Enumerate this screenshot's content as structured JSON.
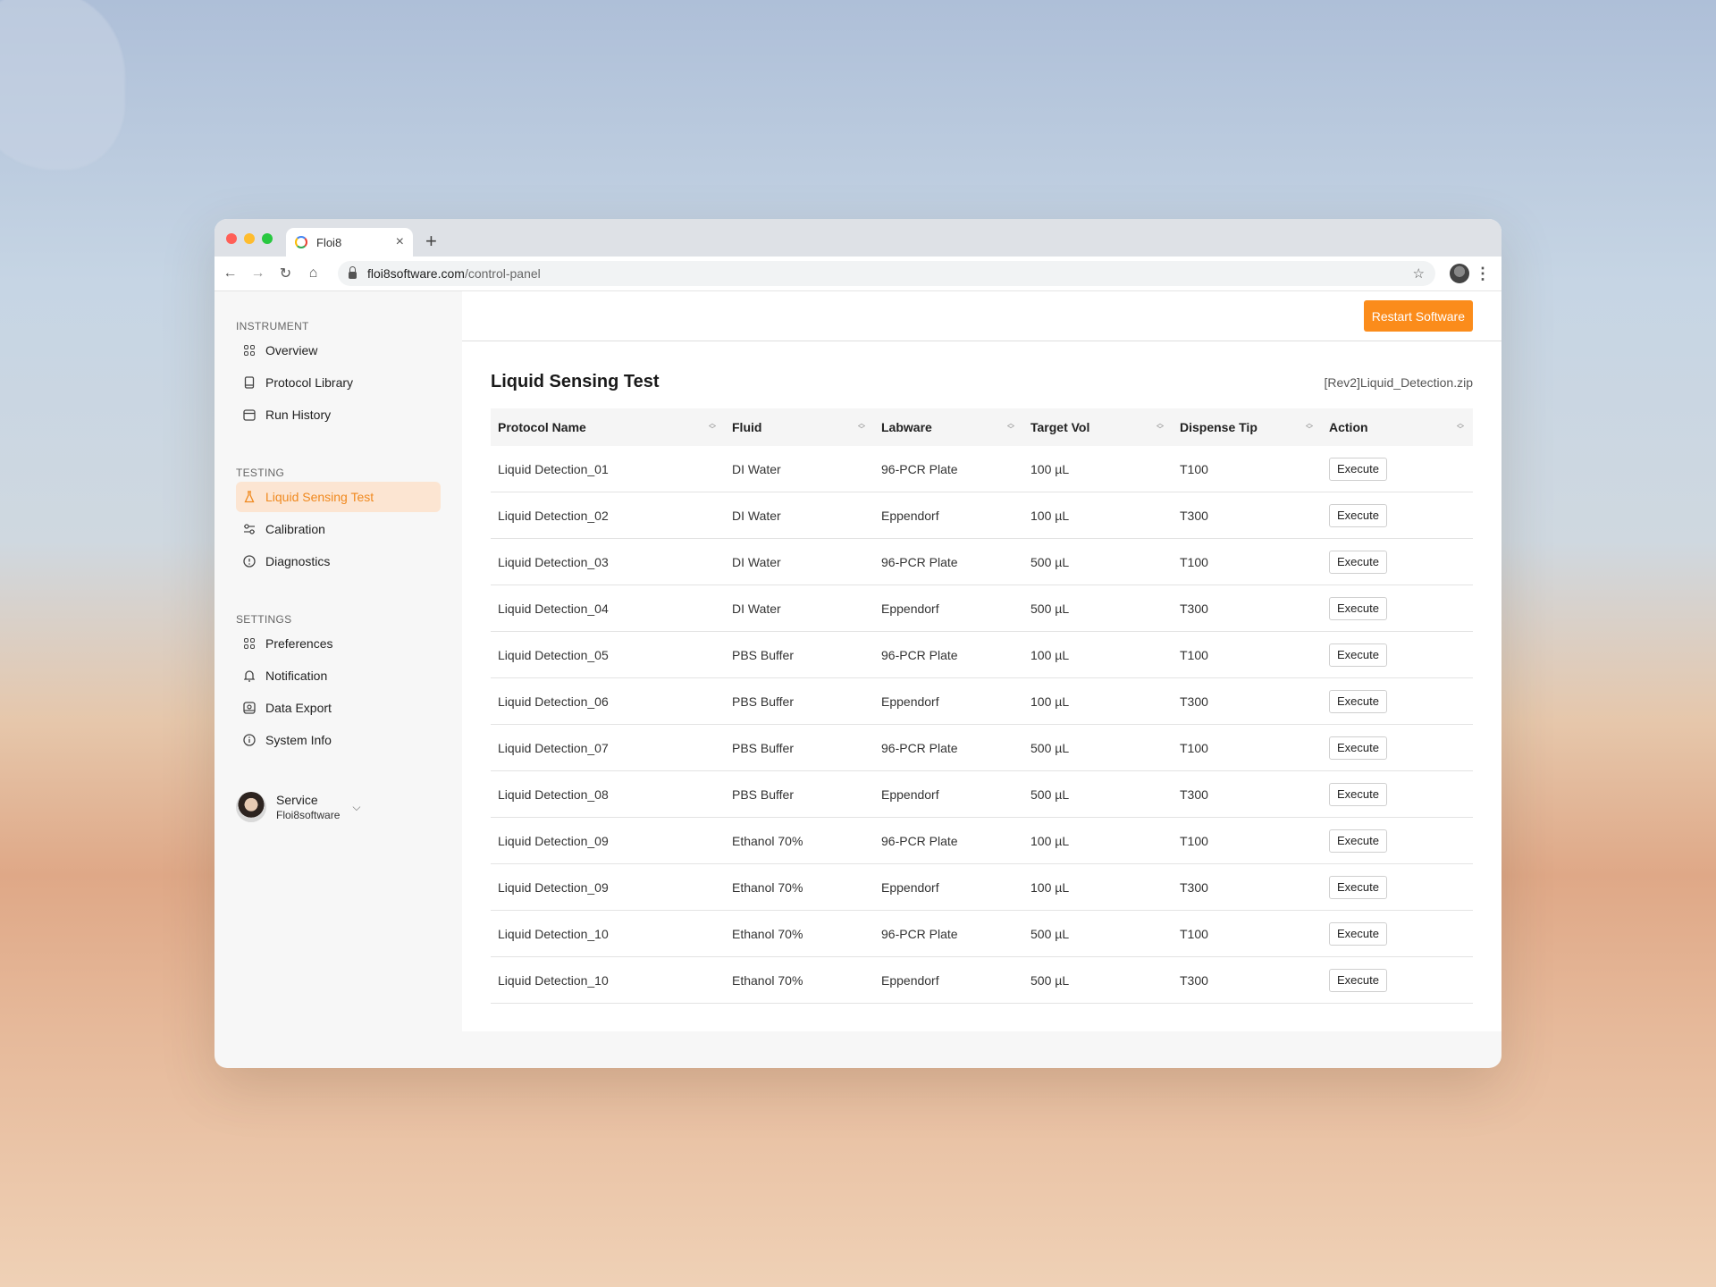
{
  "browser": {
    "tab_title": "Floi8",
    "tab_close": "×",
    "new_tab": "+",
    "url_host": "floi8software.com",
    "url_path": "/control-panel"
  },
  "sidebar": {
    "sections": [
      {
        "title": "INSTRUMENT",
        "items": [
          {
            "label": "Overview",
            "icon": "grid-icon"
          },
          {
            "label": "Protocol Library",
            "icon": "book-icon"
          },
          {
            "label": "Run History",
            "icon": "calendar-icon"
          }
        ]
      },
      {
        "title": "TESTING",
        "items": [
          {
            "label": "Liquid Sensing Test",
            "icon": "flask-icon",
            "active": true
          },
          {
            "label": "Calibration",
            "icon": "sliders-icon"
          },
          {
            "label": "Diagnostics",
            "icon": "info-icon"
          }
        ]
      },
      {
        "title": "SETTINGS",
        "items": [
          {
            "label": "Preferences",
            "icon": "grid-icon"
          },
          {
            "label": "Notification",
            "icon": "bell-icon"
          },
          {
            "label": "Data Export",
            "icon": "export-icon"
          },
          {
            "label": "System Info",
            "icon": "info-icon"
          }
        ]
      }
    ],
    "user": {
      "name": "Service",
      "org": "Floi8software"
    }
  },
  "header": {
    "restart_label": "Restart Software"
  },
  "main": {
    "title": "Liquid Sensing Test",
    "file_name": "[Rev2]Liquid_Detection.zip",
    "columns": [
      "Protocol Name",
      "Fluid",
      "Labware",
      "Target Vol",
      "Dispense Tip",
      "Action"
    ],
    "action_label": "Execute",
    "rows": [
      [
        "Liquid Detection_01",
        "DI Water",
        "96-PCR Plate",
        "100 µL",
        "T100"
      ],
      [
        "Liquid Detection_02",
        "DI Water",
        "Eppendorf",
        "100 µL",
        "T300"
      ],
      [
        "Liquid Detection_03",
        "DI Water",
        "96-PCR Plate",
        "500 µL",
        "T100"
      ],
      [
        "Liquid Detection_04",
        "DI Water",
        "Eppendorf",
        "500 µL",
        "T300"
      ],
      [
        "Liquid Detection_05",
        "PBS Buffer",
        "96-PCR Plate",
        "100 µL",
        "T100"
      ],
      [
        "Liquid Detection_06",
        "PBS Buffer",
        "Eppendorf",
        "100 µL",
        "T300"
      ],
      [
        "Liquid Detection_07",
        "PBS Buffer",
        "96-PCR Plate",
        "500 µL",
        "T100"
      ],
      [
        "Liquid Detection_08",
        "PBS Buffer",
        "Eppendorf",
        "500 µL",
        "T300"
      ],
      [
        "Liquid Detection_09",
        "Ethanol 70%",
        "96-PCR Plate",
        "100 µL",
        "T100"
      ],
      [
        "Liquid Detection_09",
        "Ethanol 70%",
        "Eppendorf",
        "100 µL",
        "T300"
      ],
      [
        "Liquid Detection_10",
        "Ethanol 70%",
        "96-PCR Plate",
        "500 µL",
        "T100"
      ],
      [
        "Liquid Detection_10",
        "Ethanol 70%",
        "Eppendorf",
        "500 µL",
        "T300"
      ]
    ]
  },
  "colors": {
    "accent": "#fb8c1b",
    "active_bg": "#fce5d2"
  }
}
